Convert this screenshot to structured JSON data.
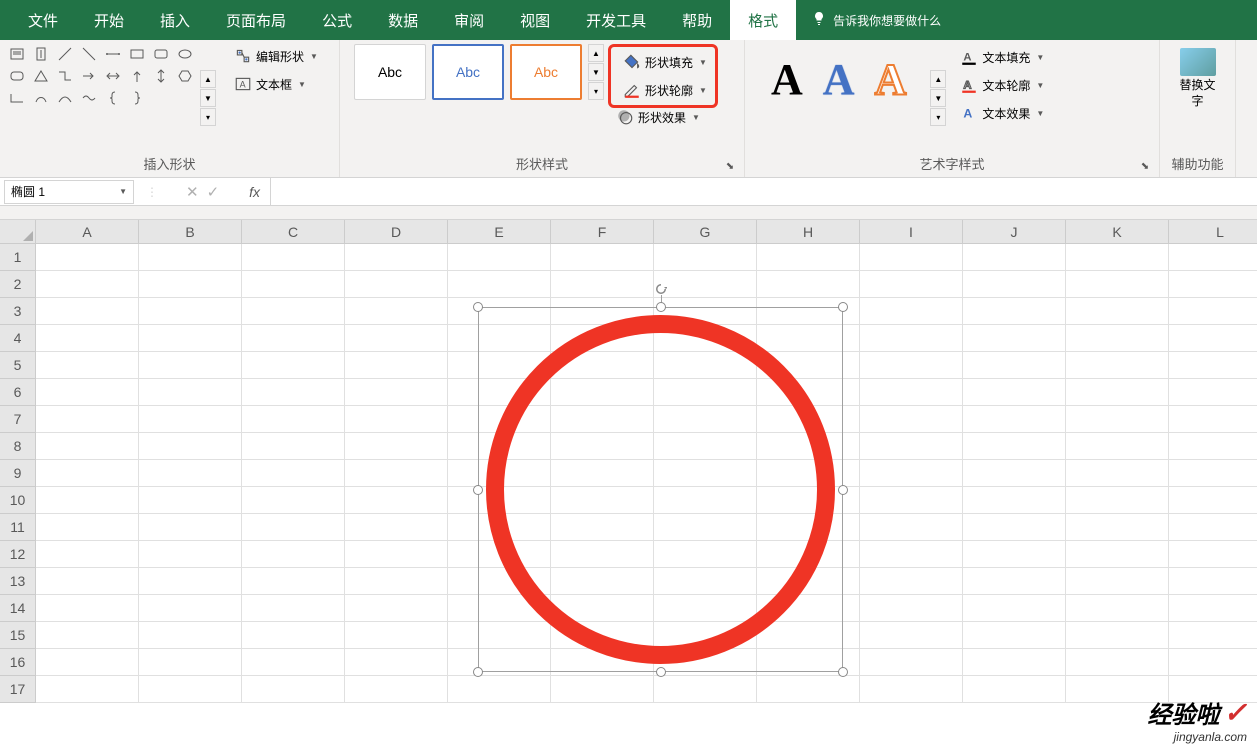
{
  "menu": {
    "items": [
      "文件",
      "开始",
      "插入",
      "页面布局",
      "公式",
      "数据",
      "审阅",
      "视图",
      "开发工具",
      "帮助",
      "格式"
    ],
    "active_index": 10,
    "tell_me": "告诉我你想要做什么"
  },
  "ribbon": {
    "insert_shapes": {
      "label": "插入形状",
      "edit_shape": "编辑形状",
      "text_box": "文本框"
    },
    "shape_styles": {
      "label": "形状样式",
      "preview_text": "Abc",
      "shape_fill": "形状填充",
      "shape_outline": "形状轮廓",
      "shape_effects": "形状效果"
    },
    "wordart_styles": {
      "label": "艺术字样式",
      "preview_text": "A",
      "text_fill": "文本填充",
      "text_outline": "文本轮廓",
      "text_effects": "文本效果"
    },
    "accessibility": {
      "label": "辅助功能",
      "replace_text": "替换文字"
    }
  },
  "formula_bar": {
    "name_box": "椭圆 1",
    "fx_label": "fx",
    "formula": ""
  },
  "grid": {
    "columns": [
      "A",
      "B",
      "C",
      "D",
      "E",
      "F",
      "G",
      "H",
      "I",
      "J",
      "K",
      "L"
    ],
    "rows": [
      "1",
      "2",
      "3",
      "4",
      "5",
      "6",
      "7",
      "8",
      "9",
      "10",
      "11",
      "12",
      "13",
      "14",
      "15",
      "16",
      "17"
    ]
  },
  "shape": {
    "name": "椭圆 1",
    "fill": "none",
    "outline_color": "#ef3425",
    "outline_width": 18
  },
  "watermark": {
    "main": "经验啦",
    "sub": "jingyanla.com"
  }
}
